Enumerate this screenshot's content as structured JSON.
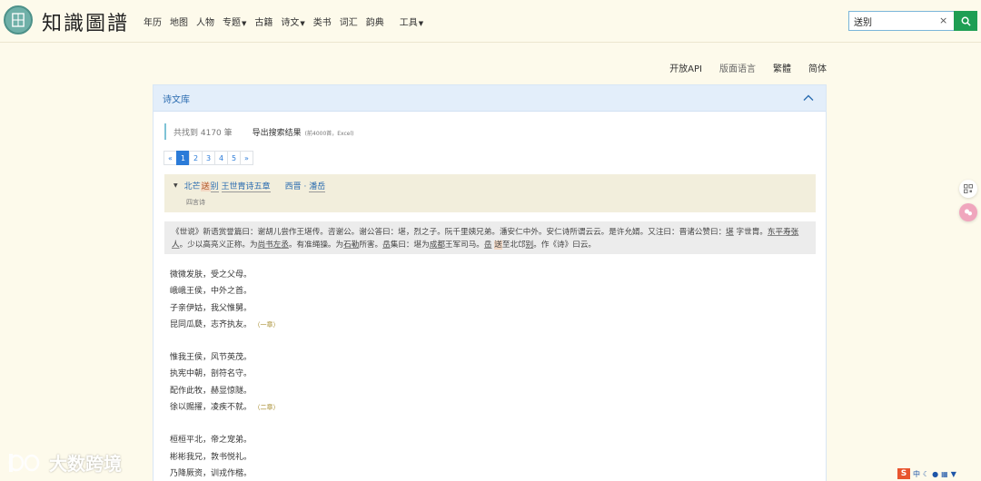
{
  "header": {
    "logo_text": "知識圖譜",
    "nav": [
      {
        "label": "年历",
        "dropdown": false
      },
      {
        "label": "地图",
        "dropdown": false
      },
      {
        "label": "人物",
        "dropdown": false
      },
      {
        "label": "专题",
        "dropdown": true
      },
      {
        "label": "古籍",
        "dropdown": false
      },
      {
        "label": "诗文",
        "dropdown": true
      },
      {
        "label": "类书",
        "dropdown": false
      },
      {
        "label": "词汇",
        "dropdown": false
      },
      {
        "label": "韵典",
        "dropdown": false
      },
      {
        "label": "工具",
        "dropdown": true
      }
    ],
    "search": {
      "value": "送别",
      "clear_label": "×"
    }
  },
  "toplinks": {
    "api": "开放API",
    "lang": "版面语言",
    "trad": "繁體",
    "simp": "简体"
  },
  "panel": {
    "title": "诗文库",
    "result_count": "共找到 4170 筆",
    "export_label": "导出搜索结果",
    "export_note": "(前4000首，Excel)",
    "pager": [
      "«",
      "1",
      "2",
      "3",
      "4",
      "5",
      "»"
    ],
    "poem": {
      "title_prefix": "北芒",
      "title_hl": "送",
      "title_mid": "别",
      "title_rest": "王世胄诗五章",
      "dynasty": "西晋",
      "sep": "·",
      "author": "潘岳",
      "form": "四言诗"
    },
    "preface": {
      "p1": "《世说》新语赏誉篇曰：谢胡儿尝作王堪传。咨谢公。谢公答曰：堪，烈之子。阮千里姨兄弟。潘安仁中外。安仁诗所谓云云。是许允婿。又注曰：晋诸公赞曰：",
      "u1": "堪",
      "p2": " 字世胄。",
      "u2": "东平寿张人",
      "p3": "。少以高亮义正称。为",
      "u3": "尚书左丞",
      "p4": "。有准绳操。为",
      "u4": "石勒",
      "p5": "所害。",
      "u5": "岳",
      "p6": "集曰：堪为",
      "u6": "成都",
      "p7": "王军司马。",
      "u7": "岳",
      "hl": "送",
      "p8": "至北邙",
      "u8": "别",
      "p9": "。作《诗》曰云。"
    },
    "stanzas": [
      {
        "lines": [
          "微微发肤，受之父母。",
          "峨峨王侯，中外之首。",
          "子亲伊姑，我父惟舅。",
          "昆同瓜瓞，志齐执友。"
        ],
        "mark": "（一章）"
      },
      {
        "lines": [
          "惟我王侯，风节英茂。",
          "执宪中朝，剖符名守。",
          "配作此牧，赫显惊隧。",
          "徐以赐擢，凌疾不就。"
        ],
        "mark": "（二章）"
      },
      {
        "lines": [
          "桓桓平北，帝之宠弟。",
          "彬彬我兄，敦书悦礼。",
          "乃降厥资，训戎作楷。"
        ],
        "mark": ""
      }
    ]
  },
  "watermark": {
    "text": "大数跨境"
  },
  "ime": {
    "s": "S",
    "label": "中"
  }
}
